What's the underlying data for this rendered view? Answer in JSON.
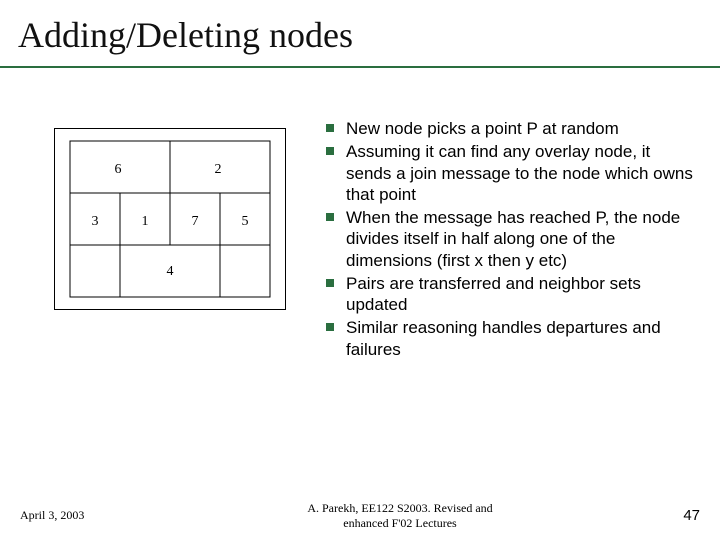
{
  "title": "Adding/Deleting  nodes",
  "diagram": {
    "labels": {
      "topLeft": "6",
      "topRight": "2",
      "midL": "3",
      "midML": "1",
      "midMR": "7",
      "midR": "5",
      "bottom": "4"
    }
  },
  "bullets": [
    "New node picks a point P at random",
    "Assuming it can find any overlay node, it sends a join message to the node which owns that point",
    "When the message has reached P, the node divides itself in half along one of the dimensions (first x then y etc)",
    "Pairs are transferred and neighbor sets updated",
    "Similar reasoning handles departures and failures"
  ],
  "footer": {
    "date": "April 3, 2003",
    "credit_line1": "A. Parekh, EE122 S2003. Revised and",
    "credit_line2": "enhanced  F'02 Lectures",
    "page": "47"
  }
}
